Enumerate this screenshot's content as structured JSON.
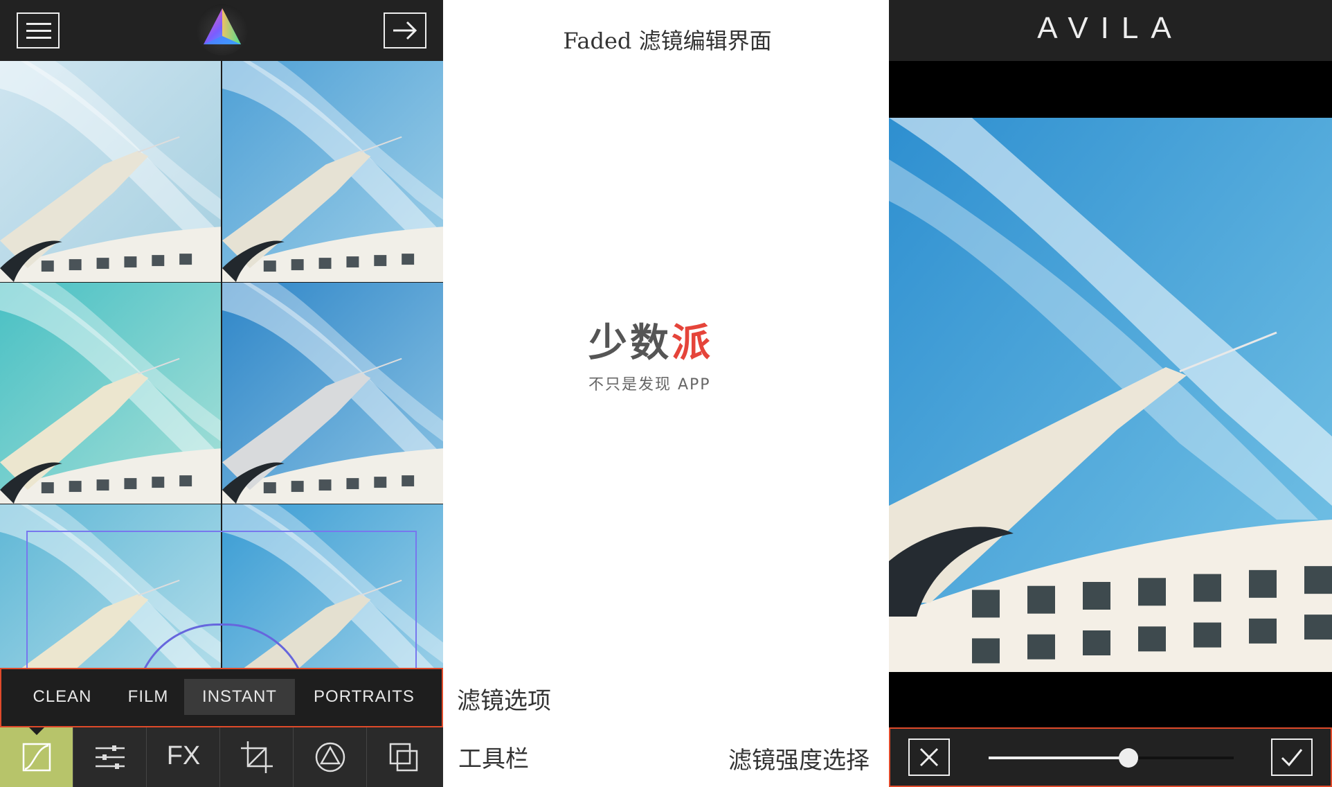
{
  "left": {
    "menu_icon": "hamburger-menu-icon",
    "logo_icon": "prism-triangle-logo",
    "next_icon": "arrow-right-icon",
    "filter_tabs": [
      {
        "label": "CLEAN",
        "active": false
      },
      {
        "label": "FILM",
        "active": false
      },
      {
        "label": "INSTANT",
        "active": true
      },
      {
        "label": "PORTRAITS",
        "active": false
      }
    ],
    "tools": [
      "curves-icon",
      "sliders-icon",
      "fx-icon",
      "crop-icon",
      "triangle-circle-icon",
      "layers-icon"
    ],
    "fx_label": "FX"
  },
  "middle": {
    "title": "Faded  滤镜编辑界面",
    "brand_main_a": "少数",
    "brand_main_b": "派",
    "brand_sub": "不只是发现 APP",
    "note_filters": "滤镜选项",
    "note_toolbar": "工具栏",
    "note_intensity": "滤镜强度选择"
  },
  "right": {
    "filter_name": "AVILA",
    "cancel_icon": "close-icon",
    "confirm_icon": "checkmark-icon",
    "intensity": 0.57
  },
  "colors": {
    "accent_orange": "#e04a2a",
    "active_tool": "#b7c46a",
    "brand_red": "#e5443a"
  }
}
